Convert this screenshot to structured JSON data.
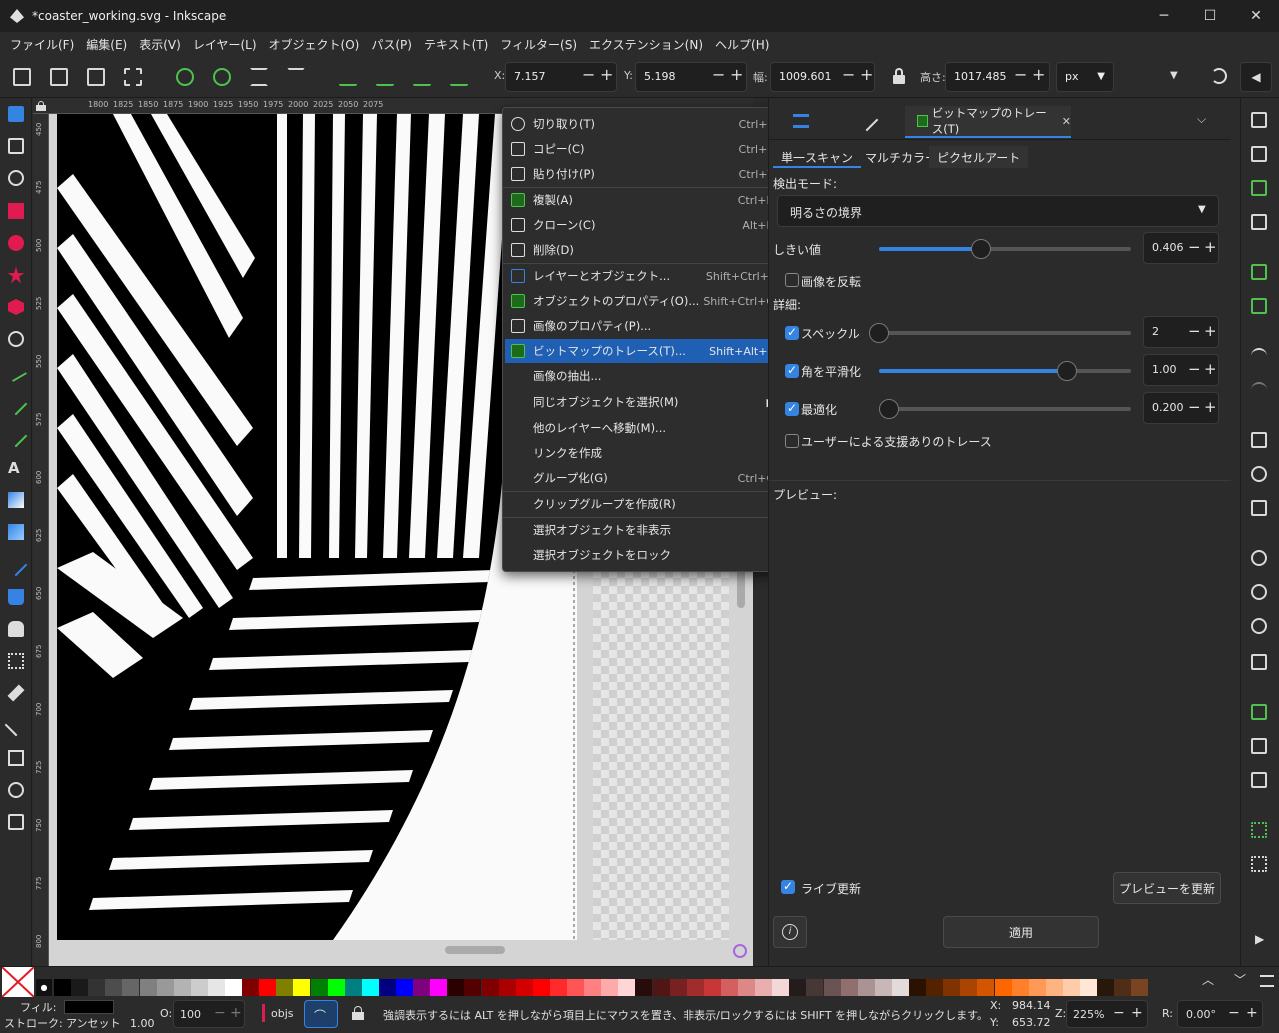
{
  "window": {
    "title": "*coaster_working.svg - Inkscape",
    "minimize": "─",
    "maximize": "☐",
    "close": "✕"
  },
  "menubar": [
    "ファイル(F)",
    "編集(E)",
    "表示(V)",
    "レイヤー(L)",
    "オブジェクト(O)",
    "パス(P)",
    "テキスト(T)",
    "フィルター(S)",
    "エクステンション(N)",
    "ヘルプ(H)"
  ],
  "toolbar": {
    "x_label": "X:",
    "x_value": "7.157",
    "y_label": "Y:",
    "y_value": "5.198",
    "w_label": "幅:",
    "w_value": "1009.601",
    "h_label": "高さ:",
    "h_value": "1017.485",
    "unit": "px"
  },
  "ruler_h": [
    "1800",
    "1825",
    "1850",
    "1875",
    "1900",
    "1925",
    "1950",
    "1975",
    "2000",
    "2025",
    "2050",
    "2075"
  ],
  "ruler_v": [
    "450",
    "475",
    "500",
    "525",
    "550",
    "575",
    "600",
    "625",
    "650",
    "675",
    "700",
    "725",
    "750",
    "775",
    "800"
  ],
  "context_menu": [
    {
      "label": "切り取り(T)",
      "shortcut": "Ctrl+X",
      "icon": "scissors-icon"
    },
    {
      "label": "コピー(C)",
      "shortcut": "Ctrl+C",
      "icon": "copy-icon"
    },
    {
      "label": "貼り付け(P)",
      "shortcut": "Ctrl+V",
      "icon": "paste-icon"
    },
    {
      "label": "複製(A)",
      "shortcut": "Ctrl+D",
      "icon": "duplicate-icon"
    },
    {
      "label": "クローン(C)",
      "shortcut": "Alt+D",
      "icon": "clone-icon"
    },
    {
      "label": "削除(D)",
      "shortcut": "",
      "icon": "trash-icon"
    },
    {
      "label": "レイヤーとオブジェクト...",
      "shortcut": "Shift+Ctrl+L",
      "icon": "layers-icon"
    },
    {
      "label": "オブジェクトのプロパティ(O)...",
      "shortcut": "Shift+Ctrl+O",
      "icon": "object-properties-icon"
    },
    {
      "label": "画像のプロパティ(P)...",
      "shortcut": "",
      "icon": "image-properties-icon"
    },
    {
      "label": "ビットマップのトレース(T)...",
      "shortcut": "Shift+Alt+B",
      "icon": "trace-bitmap-icon"
    },
    {
      "label": "画像の抽出...",
      "shortcut": "",
      "icon": ""
    },
    {
      "label": "同じオブジェクトを選択(M)",
      "shortcut": "▶",
      "icon": ""
    },
    {
      "label": "他のレイヤーへ移動(M)...",
      "shortcut": "",
      "icon": ""
    },
    {
      "label": "リンクを作成",
      "shortcut": "",
      "icon": ""
    },
    {
      "label": "グループ化(G)",
      "shortcut": "Ctrl+G",
      "icon": ""
    },
    {
      "label": "クリップグループを作成(R)",
      "shortcut": "",
      "icon": ""
    },
    {
      "label": "選択オブジェクトを非表示",
      "shortcut": "",
      "icon": ""
    },
    {
      "label": "選択オブジェクトをロック",
      "shortcut": "",
      "icon": ""
    }
  ],
  "panel": {
    "active_tab": "ビットマップのトレース(T)",
    "tab_close": "✕",
    "subtabs": [
      "単一スキャン",
      "マルチカラー",
      "ピクセルアート"
    ],
    "detect_mode_label": "検出モード:",
    "detect_mode_value": "明るさの境界",
    "threshold_label": "しきい値",
    "threshold_value": "0.406",
    "threshold_level": 0.406,
    "invert_label": "画像を反転",
    "detail_label": "詳細:",
    "speckle_label": "スペックル",
    "speckle_value": "2",
    "smooth_label": "角を平滑化",
    "smooth_value": "1.00",
    "optimize_label": "最適化",
    "optimize_value": "0.200",
    "assisted_label": "ユーザーによる支援ありのトレース",
    "preview_label": "プレビュー:",
    "live_update_label": "ライブ更新",
    "update_preview_button": "プレビューを更新",
    "apply_button": "適用"
  },
  "status": {
    "fill_label": "フィル:",
    "stroke_label": "ストローク:",
    "stroke_value": "アンセット",
    "stroke_width": "1.00",
    "opacity_label": "O:",
    "opacity_value": "100",
    "layer_name": "objs",
    "message": "強調表示するには ALT を押しながら項目上にマウスを置き、非表示/ロックするには SHIFT を押しながらクリックします。",
    "x_label": "X:",
    "x_value": "984.14",
    "y_label": "Y:",
    "y_value": "653.72",
    "zoom_label": "Z:",
    "zoom_value": "225%",
    "rotate_label": "R:",
    "rotate_value": "0.00°"
  },
  "palette_colors": [
    "#000000",
    "#1a1a1a",
    "#333333",
    "#4d4d4d",
    "#666666",
    "#808080",
    "#999999",
    "#b3b3b3",
    "#cccccc",
    "#e6e6e6",
    "#ffffff",
    "#800000",
    "#ff0000",
    "#808000",
    "#ffff00",
    "#008000",
    "#00ff00",
    "#008080",
    "#00ffff",
    "#000080",
    "#0000ff",
    "#800080",
    "#ff00ff",
    "#2b0000",
    "#550000",
    "#800000",
    "#aa0000",
    "#d40000",
    "#ff0000",
    "#ff2a2a",
    "#ff5555",
    "#ff8080",
    "#ffaaaa",
    "#ffd5d5",
    "#280b0b",
    "#501616",
    "#782121",
    "#a02c2c",
    "#c83737",
    "#d35f5f",
    "#de8787",
    "#e9afaf",
    "#f4d7d7",
    "#241c1c",
    "#483737",
    "#6c5353",
    "#916f6f",
    "#ac9393",
    "#c8b7b7",
    "#e3dbdb",
    "#2b1100",
    "#552200",
    "#803300",
    "#aa4400",
    "#d45500",
    "#ff6600",
    "#ff7f2a",
    "#ff9955",
    "#ffb380",
    "#ffccaa",
    "#ffe6d5",
    "#28170b",
    "#502d16",
    "#784421"
  ]
}
